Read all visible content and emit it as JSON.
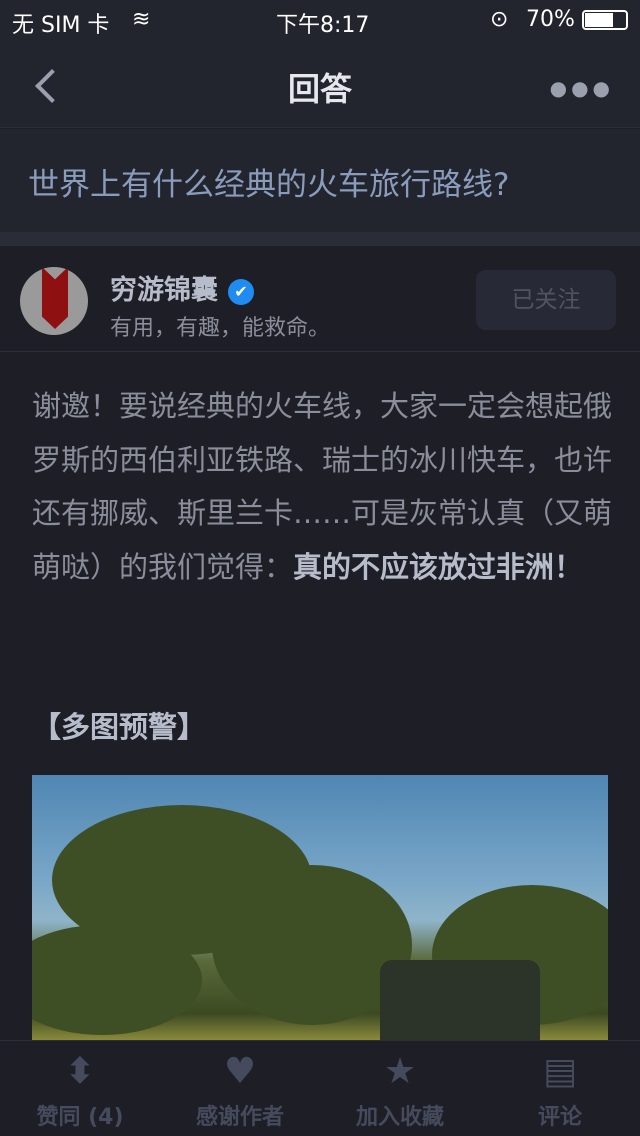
{
  "status": {
    "carrier": "无 SIM 卡",
    "time": "下午8:17",
    "battery": "70%"
  },
  "nav": {
    "title": "回答"
  },
  "question": "世界上有什么经典的火车旅行路线?",
  "author": {
    "name": "穷游锦囊",
    "bio": "有用，有趣，能救命。",
    "follow": "已关注"
  },
  "body": {
    "text": "谢邀！要说经典的火车线，大家一定会想起俄罗斯的西伯利亚铁路、瑞士的冰川快车，也许还有挪威、斯里兰卡……可是灰常认真（又萌萌哒）的我们觉得：",
    "bold": "真的不应该放过非洲！",
    "heading": "【多图预警】"
  },
  "tabs": [
    {
      "label": "赞同 (4)",
      "icon": "vote-icon"
    },
    {
      "label": "感谢作者",
      "icon": "heart-icon"
    },
    {
      "label": "加入收藏",
      "icon": "star-icon"
    },
    {
      "label": "评论",
      "icon": "comment-icon"
    }
  ]
}
